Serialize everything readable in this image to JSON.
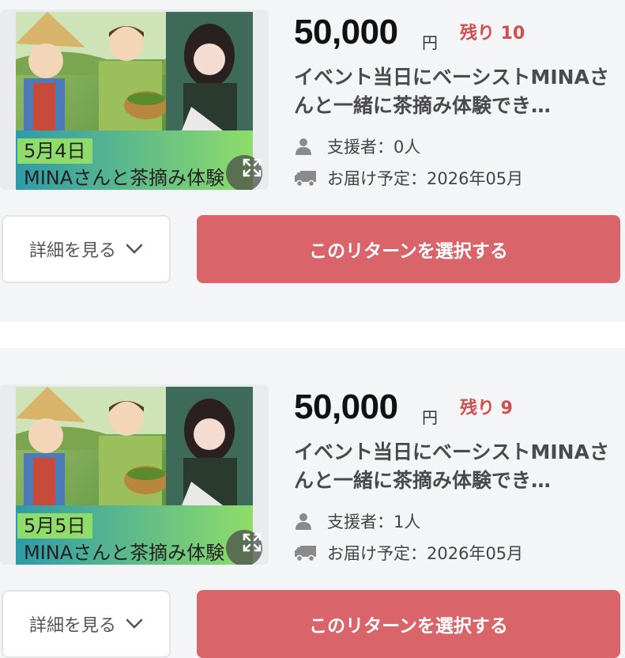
{
  "rewards": [
    {
      "thumb_date": "5月4日",
      "thumb_title": "MINAさんと茶摘み体験",
      "price": "50,000",
      "currency": "円",
      "remaining": "残り 10",
      "title": "イベント当日にベーシストMINAさんと一緒に茶摘み体験でき…",
      "supporters": "支援者：0人",
      "delivery": "お届け予定：2026年05月",
      "detail_label": "詳細を見る",
      "select_label": "このリターンを選択する"
    },
    {
      "thumb_date": "5月5日",
      "thumb_title": "MINAさんと茶摘み体験",
      "price": "50,000",
      "currency": "円",
      "remaining": "残り 9",
      "title": "イベント当日にベーシストMINAさんと一緒に茶摘み体験でき…",
      "supporters": "支援者：1人",
      "delivery": "お届け予定：2026年05月",
      "detail_label": "詳細を見る",
      "select_label": "このリターンを選択する"
    }
  ],
  "icons": {
    "supporters": "person-icon",
    "delivery": "truck-icon",
    "expand": "expand-icon",
    "chevron": "chevron-down-icon"
  },
  "colors": {
    "accent": "#d9646a",
    "remaining": "#d24d4d",
    "card_bg": "#f4f5f7"
  }
}
